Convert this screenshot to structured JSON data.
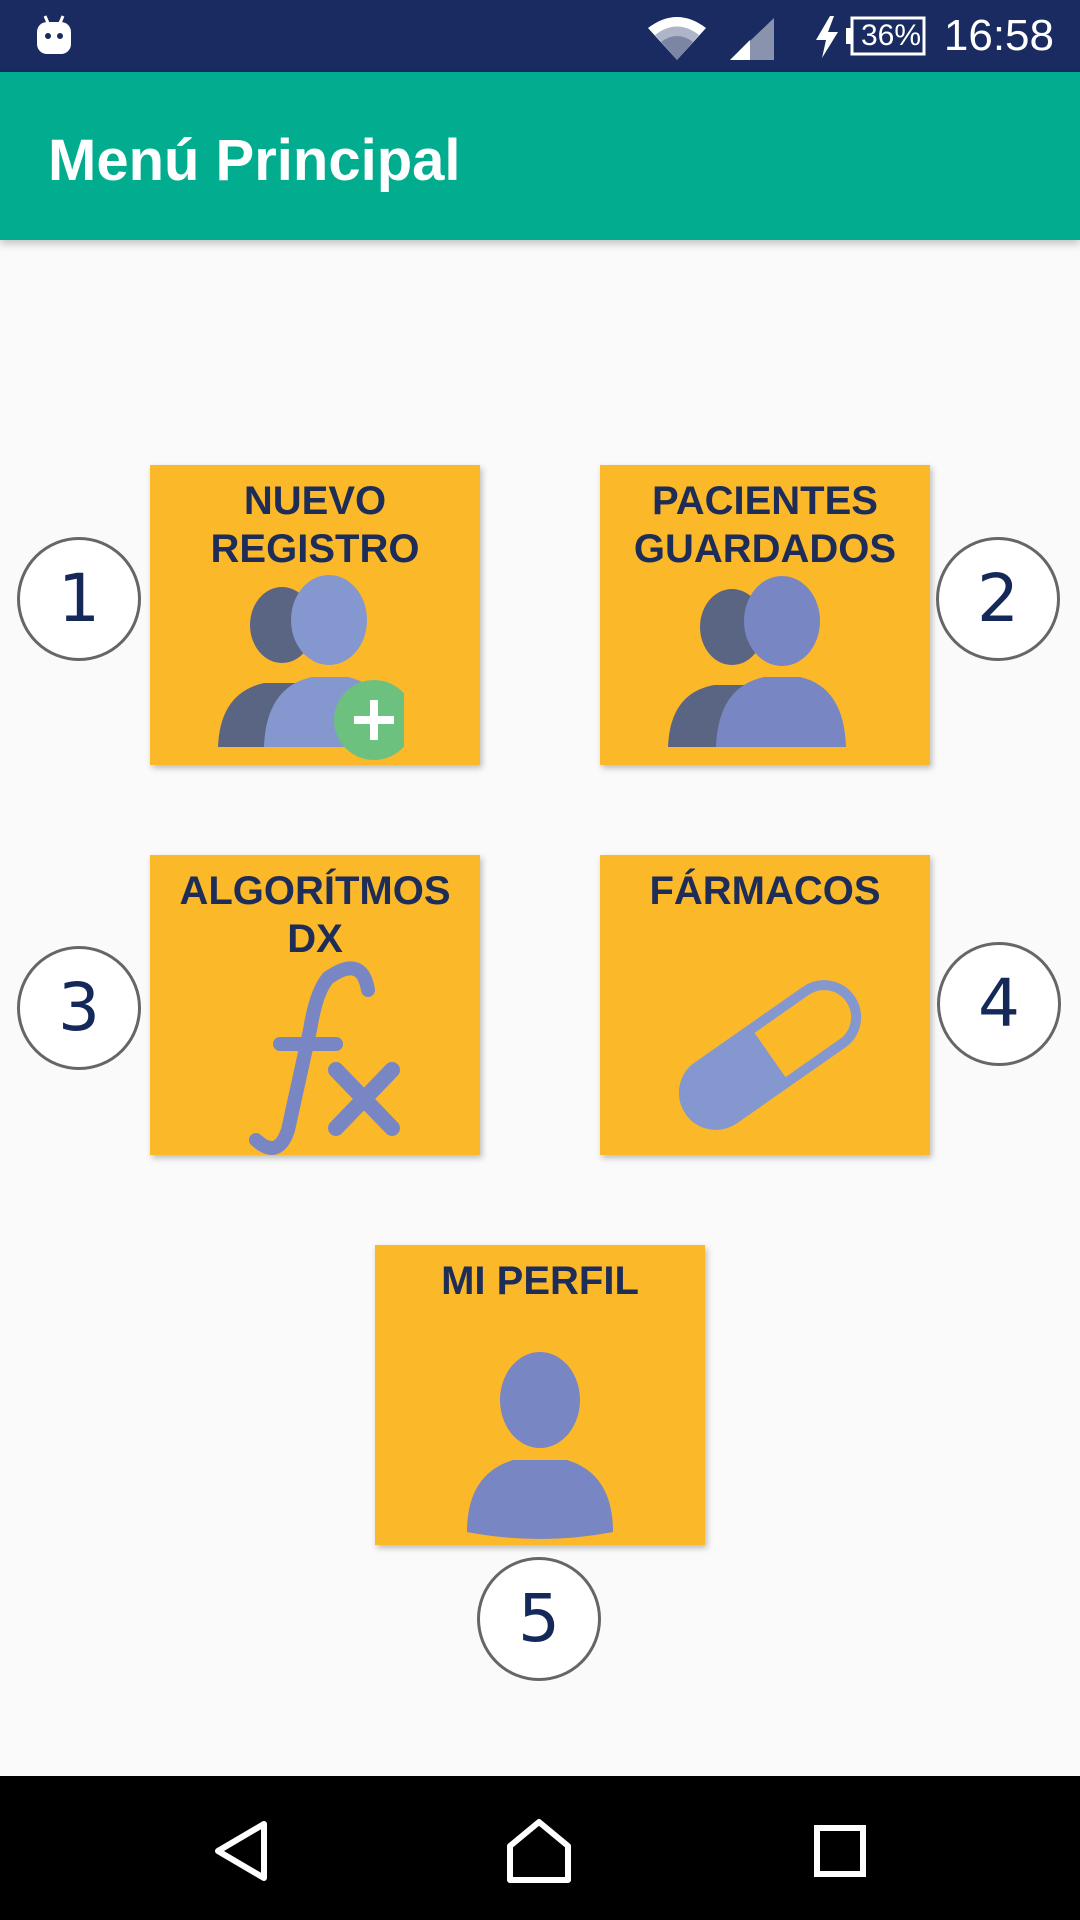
{
  "status_bar": {
    "time": "16:58",
    "battery_percent": "36%",
    "icons": [
      "android-icon",
      "wifi-icon",
      "signal-icon",
      "charging-bolt-icon",
      "battery-icon"
    ]
  },
  "app_bar": {
    "title": "Menú Principal"
  },
  "tiles": [
    {
      "label": "NUEVO\nREGISTRO",
      "icon": "add-users-icon"
    },
    {
      "label": "PACIENTES\nGUARDADOS",
      "icon": "users-icon"
    },
    {
      "label": "ALGORÍTMOS DX",
      "icon": "function-fx-icon"
    },
    {
      "label": "FÁRMACOS",
      "icon": "pill-capsule-icon"
    },
    {
      "label": "MI PERFIL",
      "icon": "user-icon"
    }
  ],
  "annotations": [
    "1",
    "2",
    "3",
    "4",
    "5"
  ],
  "nav_bar": {
    "icons": [
      "back-triangle-icon",
      "home-icon",
      "recent-apps-icon"
    ]
  },
  "colors": {
    "status_bar": "#1a2b62",
    "app_bar": "#01ad8e",
    "tile": "#fbb829",
    "tile_text": "#1e2d57",
    "icon_light": "#7886c4",
    "icon_dark": "#5a6584",
    "plus_badge": "#6cc17f"
  }
}
